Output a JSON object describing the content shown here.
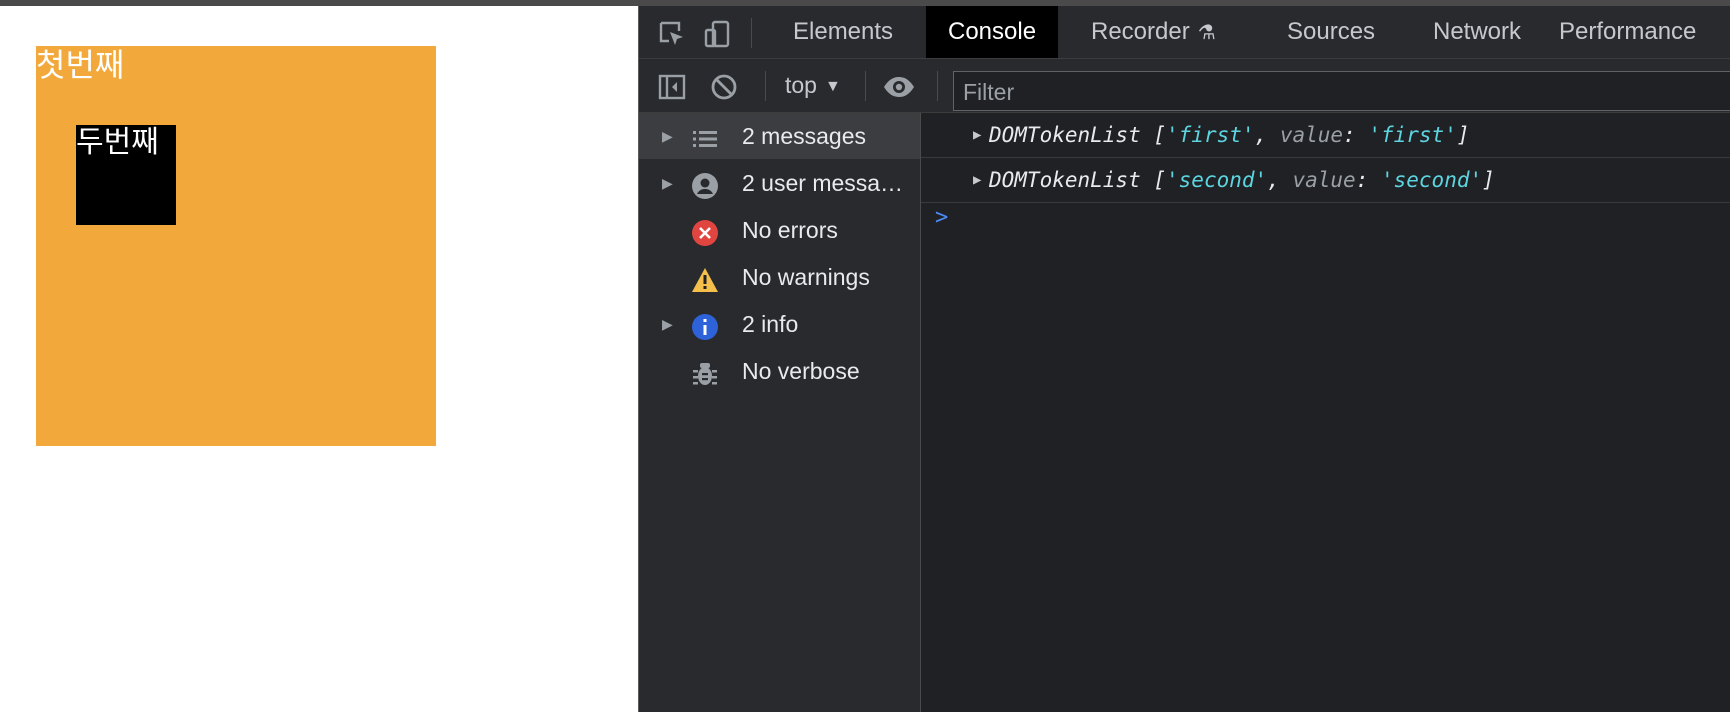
{
  "page": {
    "first_box_label": "첫번째",
    "second_box_label": "두번째",
    "first_box_color": "#f2a83a",
    "second_box_color": "#000000"
  },
  "devtools": {
    "tabs": [
      {
        "label": "Elements",
        "active": false
      },
      {
        "label": "Console",
        "active": true
      },
      {
        "label": "Recorder",
        "active": false,
        "icon": "flask-icon"
      },
      {
        "label": "Sources",
        "active": false
      },
      {
        "label": "Network",
        "active": false
      },
      {
        "label": "Performance",
        "active": false
      }
    ],
    "toolbar": {
      "context": "top",
      "filter_placeholder": "Filter"
    },
    "sidebar": [
      {
        "label": "2 messages",
        "icon": "list-icon",
        "expandable": true,
        "selected": true
      },
      {
        "label": "2 user messa…",
        "icon": "user-icon",
        "expandable": true,
        "selected": false
      },
      {
        "label": "No errors",
        "icon": "error-icon",
        "expandable": false,
        "selected": false
      },
      {
        "label": "No warnings",
        "icon": "warning-icon",
        "expandable": false,
        "selected": false
      },
      {
        "label": "2 info",
        "icon": "info-icon",
        "expandable": true,
        "selected": false
      },
      {
        "label": "No verbose",
        "icon": "bug-icon",
        "expandable": false,
        "selected": false
      }
    ],
    "messages": [
      {
        "type": "DOMTokenList",
        "item": "'first'",
        "key": "value",
        "value": "'first'"
      },
      {
        "type": "DOMTokenList",
        "item": "'second'",
        "key": "value",
        "value": "'second'"
      }
    ],
    "prompt": ">"
  }
}
